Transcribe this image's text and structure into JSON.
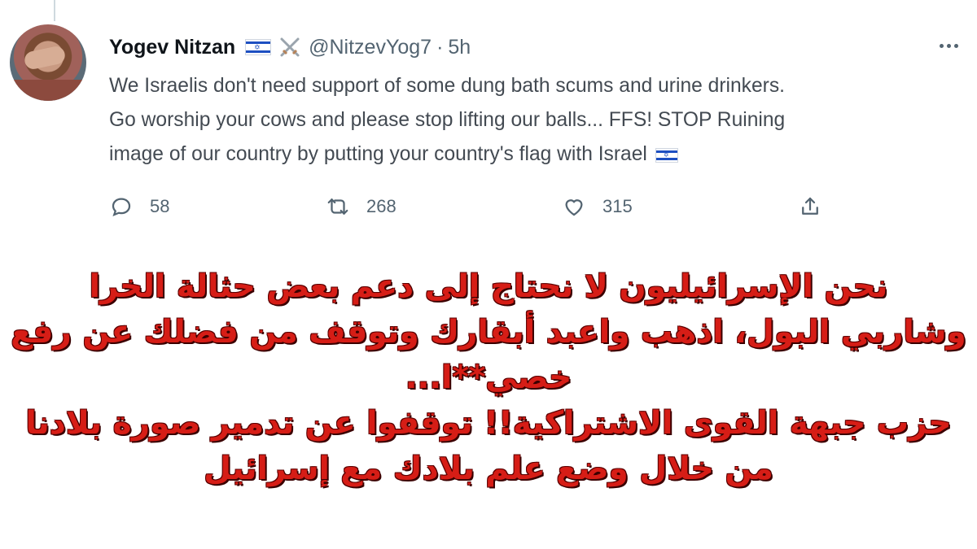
{
  "tweet": {
    "author_name": "Yogev Nitzan",
    "author_emojis": [
      "israel-flag-icon",
      "crossed-swords-icon"
    ],
    "handle": "@NitzevYog7",
    "separator": "·",
    "time": "5h",
    "text_lines": [
      "We Israelis don't need support of some dung bath scums and urine drinkers.",
      "Go worship your cows and please stop lifting our balls... FFS! STOP Ruining",
      "image of our country by putting your country's flag with Israel"
    ],
    "actions": {
      "reply_count": "58",
      "retweet_count": "268",
      "like_count": "315"
    }
  },
  "overlay_lines": [
    "نحن الإسرائيليون لا نحتاج إلى دعم بعض حثالة الخرا",
    "وشاربي البول، اذهب واعبد أبقارك وتوقف من فضلك عن رفع",
    "خصي**ا...",
    "حزب جبهة القوى الاشتراكية!! توقفوا عن تدمير صورة بلادنا",
    "من خلال وضع علم بلادك مع إسرائيل"
  ],
  "colors": {
    "overlay_text": "#d61d16",
    "name": "#0f1419",
    "muted": "#536471",
    "flag_blue": "#1d4fc1"
  }
}
